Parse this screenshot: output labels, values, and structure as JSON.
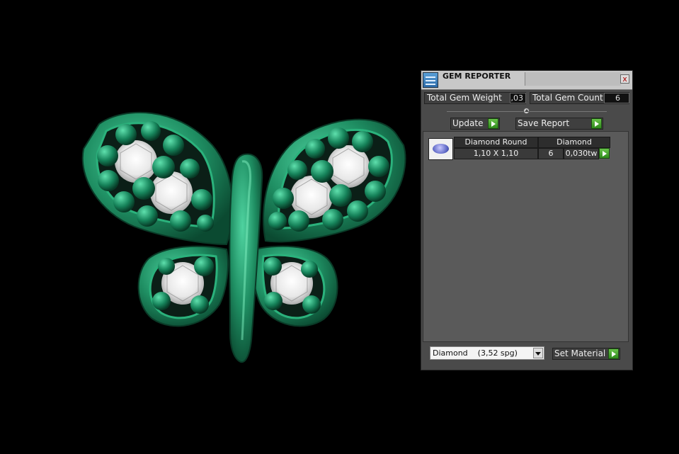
{
  "panel": {
    "title": "GEM REPORTER",
    "close_label": "x",
    "total_weight_label": "Total Gem Weight",
    "total_weight_value": ",03",
    "total_count_label": "Total Gem Count",
    "total_count_value": "6",
    "update_label": "Update",
    "save_report_label": "Save Report",
    "list": {
      "columns": [
        "Diamond Round",
        "Diamond"
      ],
      "rows": [
        {
          "shape": "Diamond Round",
          "size": "1,10 X 1,10",
          "count": "6",
          "weight": "0,030tw"
        }
      ]
    },
    "material_value": "Diamond    (3,52 spg)",
    "set_material_label": "Set Material"
  },
  "colors": {
    "metal": "#1f8f63",
    "accent_button": "#3da52a",
    "panel_bg": "#4a4a4a"
  }
}
